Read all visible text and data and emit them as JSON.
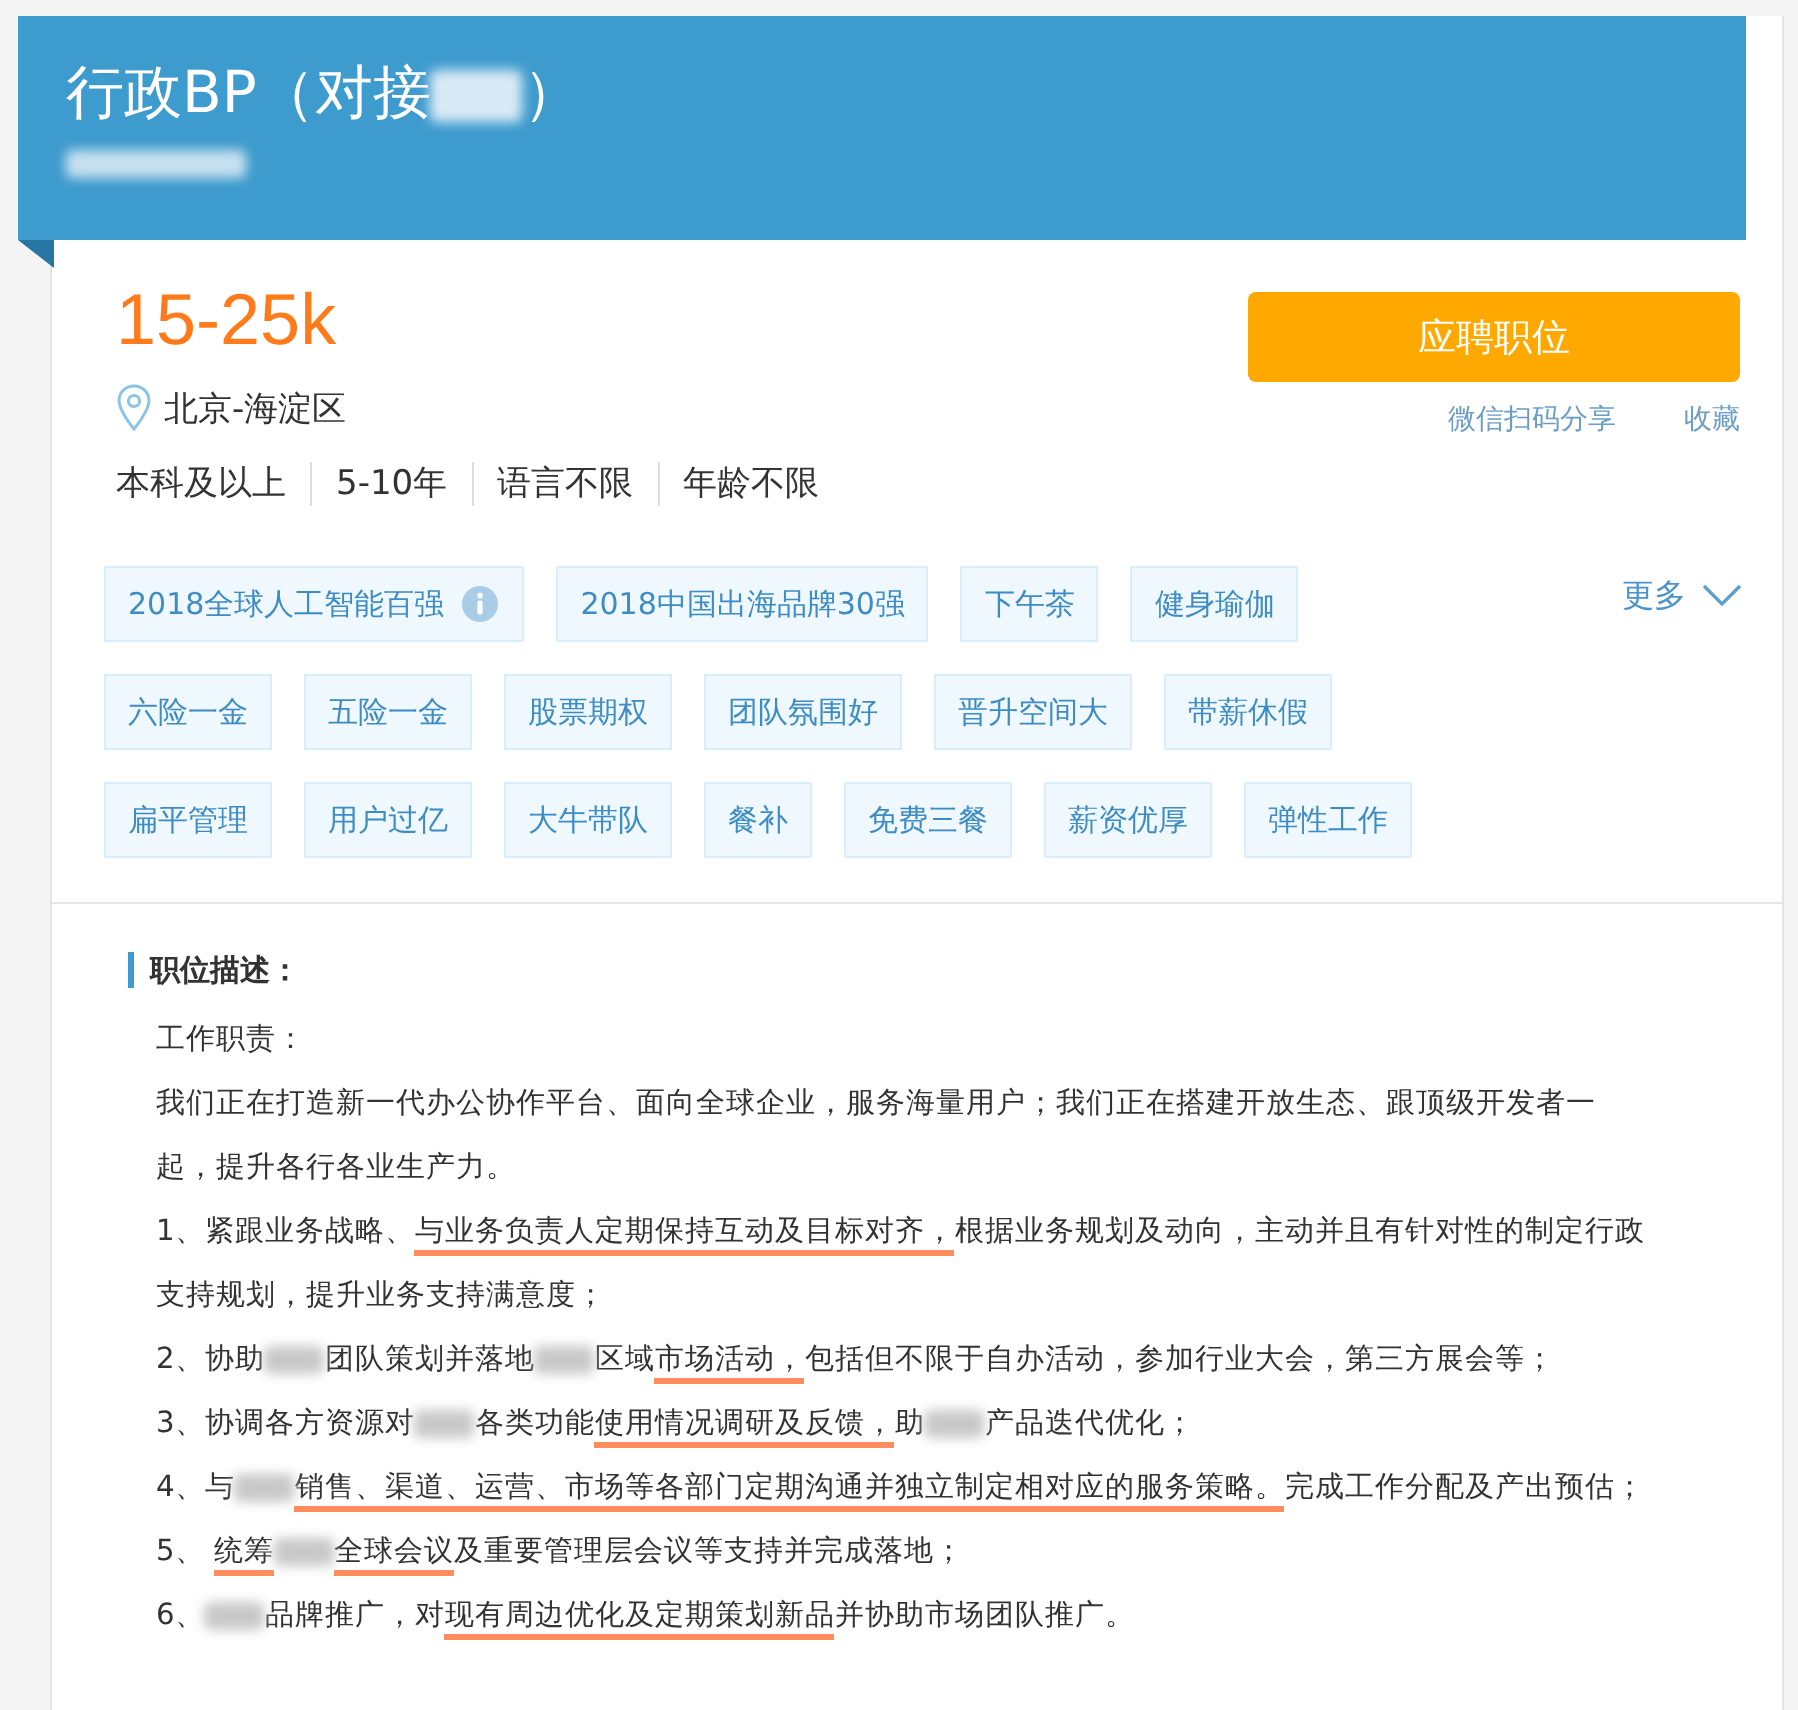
{
  "header": {
    "title": [
      {
        "kind": "text",
        "text": "行政BP（对接"
      },
      {
        "kind": "redacted"
      },
      {
        "kind": "text",
        "text": "）"
      }
    ],
    "subtitle": [
      {
        "kind": "redacted"
      }
    ]
  },
  "salary": "15-25k",
  "apply_button": "应聘职位",
  "links": [
    "微信扫码分享",
    "收藏"
  ],
  "location": "北京-海淀区",
  "requirements": [
    "本科及以上",
    "5-10年",
    "语言不限",
    "年龄不限"
  ],
  "tag_rows": [
    [
      {
        "label": "2018全球人工智能百强",
        "info": true
      },
      {
        "label": "2018中国出海品牌30强",
        "info": false
      },
      {
        "label": "下午茶",
        "info": false
      },
      {
        "label": "健身瑜伽",
        "info": false
      }
    ],
    [
      {
        "label": "六险一金",
        "info": false
      },
      {
        "label": "五险一金",
        "info": false
      },
      {
        "label": "股票期权",
        "info": false
      },
      {
        "label": "团队氛围好",
        "info": false
      },
      {
        "label": "晋升空间大",
        "info": false
      },
      {
        "label": "带薪休假",
        "info": false
      }
    ],
    [
      {
        "label": "扁平管理",
        "info": false
      },
      {
        "label": "用户过亿",
        "info": false
      },
      {
        "label": "大牛带队",
        "info": false
      },
      {
        "label": "餐补",
        "info": false
      },
      {
        "label": "免费三餐",
        "info": false
      },
      {
        "label": "薪资优厚",
        "info": false
      },
      {
        "label": "弹性工作",
        "info": false
      }
    ]
  ],
  "more_button": "更多",
  "description": {
    "heading": "职位描述：",
    "paragraphs": [
      [
        {
          "kind": "text",
          "text": "工作职责："
        }
      ],
      [
        {
          "kind": "text",
          "text": "我们正在打造新一代办公协作平台、面向全球企业，服务海量用户；我们正在搭建开放生态、跟顶级开发者一起，提升各行各业生产力。"
        }
      ],
      [
        {
          "kind": "text",
          "text": "1、紧跟业务战略、"
        },
        {
          "kind": "underlined",
          "text": "与业务负责人定期保持互动及目标对齐，"
        },
        {
          "kind": "text",
          "text": "根据业务规划及动向，主动并且有针对性的制定行政支持规划，提升业务支持满意度；"
        }
      ],
      [
        {
          "kind": "text",
          "text": "2、协助"
        },
        {
          "kind": "redacted"
        },
        {
          "kind": "text",
          "text": "团队策划并落地"
        },
        {
          "kind": "redacted"
        },
        {
          "kind": "text",
          "text": "区域"
        },
        {
          "kind": "underlined",
          "text": "市场活动，"
        },
        {
          "kind": "text",
          "text": "包括但不限于自办活动，参加行业大会，第三方展会等；"
        }
      ],
      [
        {
          "kind": "text",
          "text": "3、协调各方资源对"
        },
        {
          "kind": "redacted"
        },
        {
          "kind": "text",
          "text": "各类功能"
        },
        {
          "kind": "underlined",
          "text": "使用情况调研及反馈，"
        },
        {
          "kind": "text",
          "text": "助"
        },
        {
          "kind": "redacted"
        },
        {
          "kind": "text",
          "text": "产品迭代优化；"
        }
      ],
      [
        {
          "kind": "text",
          "text": "4、与"
        },
        {
          "kind": "redacted"
        },
        {
          "kind": "underlined",
          "text": "销售、渠道、运营、市场等各部门定期沟通并独立制定相对应的服务策略。"
        },
        {
          "kind": "text",
          "text": "完成工作分配及产出预估；"
        }
      ],
      [
        {
          "kind": "text",
          "text": "5、 "
        },
        {
          "kind": "underlined",
          "text": "统筹"
        },
        {
          "kind": "redacted"
        },
        {
          "kind": "underlined",
          "text": "全球会议"
        },
        {
          "kind": "text",
          "text": "及重要管理层会议等支持并完成落地；"
        }
      ],
      [
        {
          "kind": "text",
          "text": "6、"
        },
        {
          "kind": "redacted"
        },
        {
          "kind": "text",
          "text": "品牌推广，对"
        },
        {
          "kind": "underlined",
          "text": "现有周边优化及定期策划新品"
        },
        {
          "kind": "text",
          "text": "并协助市场团队推广。"
        }
      ]
    ]
  }
}
